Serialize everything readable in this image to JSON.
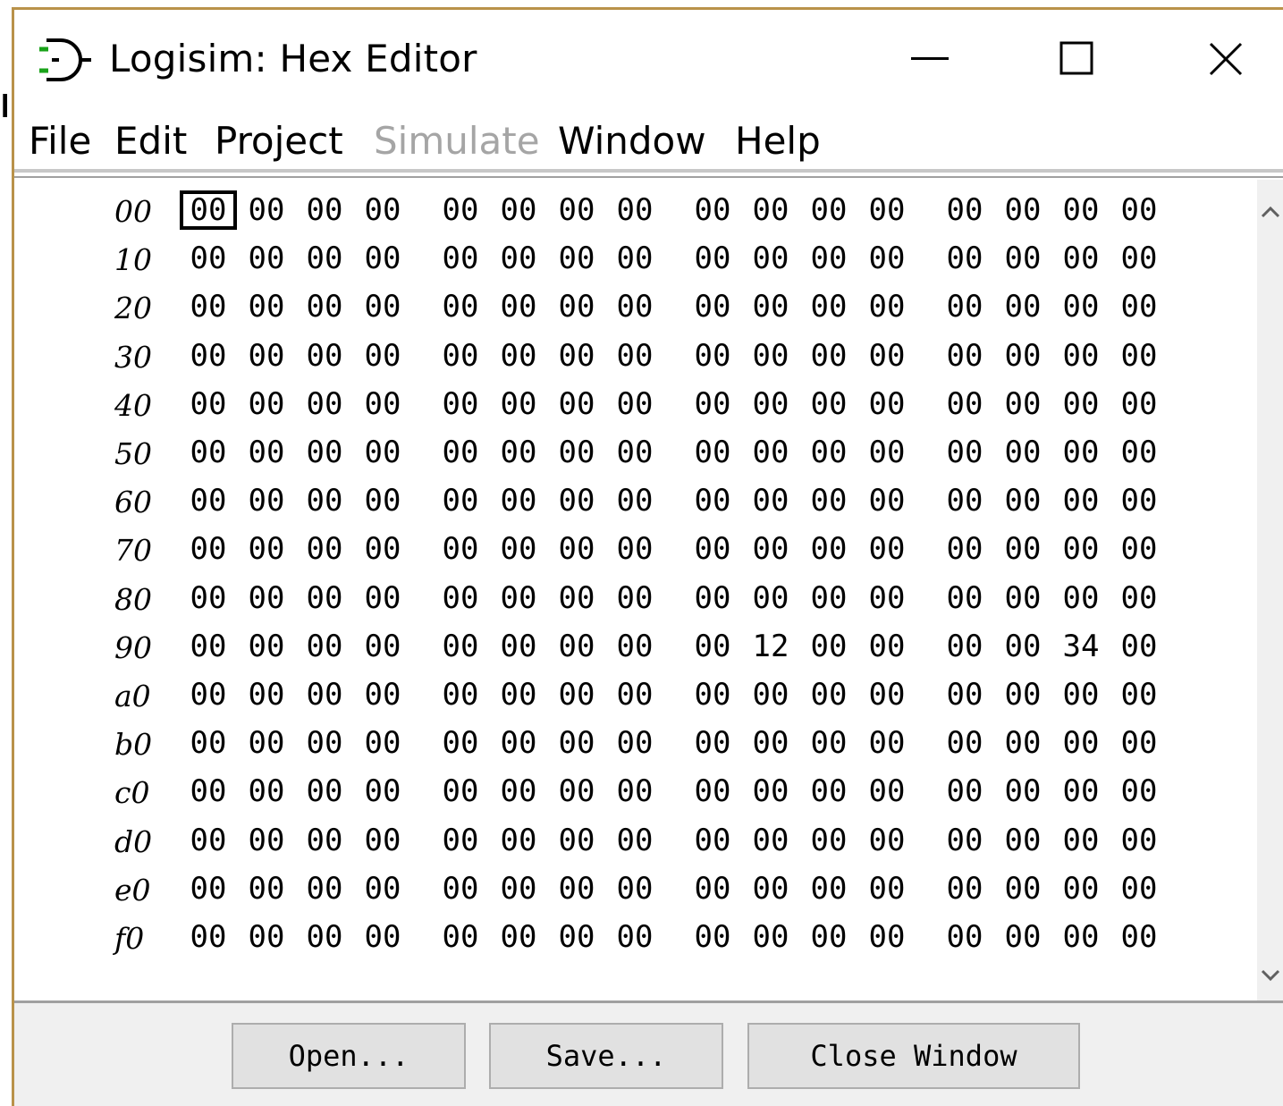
{
  "window": {
    "title": "Logisim: Hex Editor"
  },
  "menu": [
    {
      "label": "File",
      "enabled": true
    },
    {
      "label": "Edit",
      "enabled": true
    },
    {
      "label": "Project",
      "enabled": true
    },
    {
      "label": "Simulate",
      "enabled": false
    },
    {
      "label": "Window",
      "enabled": true
    },
    {
      "label": "Help",
      "enabled": true
    }
  ],
  "hex": {
    "rows": [
      {
        "addr": "00",
        "cells": [
          "00",
          "00",
          "00",
          "00",
          "00",
          "00",
          "00",
          "00",
          "00",
          "00",
          "00",
          "00",
          "00",
          "00",
          "00",
          "00"
        ]
      },
      {
        "addr": "10",
        "cells": [
          "00",
          "00",
          "00",
          "00",
          "00",
          "00",
          "00",
          "00",
          "00",
          "00",
          "00",
          "00",
          "00",
          "00",
          "00",
          "00"
        ]
      },
      {
        "addr": "20",
        "cells": [
          "00",
          "00",
          "00",
          "00",
          "00",
          "00",
          "00",
          "00",
          "00",
          "00",
          "00",
          "00",
          "00",
          "00",
          "00",
          "00"
        ]
      },
      {
        "addr": "30",
        "cells": [
          "00",
          "00",
          "00",
          "00",
          "00",
          "00",
          "00",
          "00",
          "00",
          "00",
          "00",
          "00",
          "00",
          "00",
          "00",
          "00"
        ]
      },
      {
        "addr": "40",
        "cells": [
          "00",
          "00",
          "00",
          "00",
          "00",
          "00",
          "00",
          "00",
          "00",
          "00",
          "00",
          "00",
          "00",
          "00",
          "00",
          "00"
        ]
      },
      {
        "addr": "50",
        "cells": [
          "00",
          "00",
          "00",
          "00",
          "00",
          "00",
          "00",
          "00",
          "00",
          "00",
          "00",
          "00",
          "00",
          "00",
          "00",
          "00"
        ]
      },
      {
        "addr": "60",
        "cells": [
          "00",
          "00",
          "00",
          "00",
          "00",
          "00",
          "00",
          "00",
          "00",
          "00",
          "00",
          "00",
          "00",
          "00",
          "00",
          "00"
        ]
      },
      {
        "addr": "70",
        "cells": [
          "00",
          "00",
          "00",
          "00",
          "00",
          "00",
          "00",
          "00",
          "00",
          "00",
          "00",
          "00",
          "00",
          "00",
          "00",
          "00"
        ]
      },
      {
        "addr": "80",
        "cells": [
          "00",
          "00",
          "00",
          "00",
          "00",
          "00",
          "00",
          "00",
          "00",
          "00",
          "00",
          "00",
          "00",
          "00",
          "00",
          "00"
        ]
      },
      {
        "addr": "90",
        "cells": [
          "00",
          "00",
          "00",
          "00",
          "00",
          "00",
          "00",
          "00",
          "00",
          "12",
          "00",
          "00",
          "00",
          "00",
          "34",
          "00"
        ]
      },
      {
        "addr": "a0",
        "cells": [
          "00",
          "00",
          "00",
          "00",
          "00",
          "00",
          "00",
          "00",
          "00",
          "00",
          "00",
          "00",
          "00",
          "00",
          "00",
          "00"
        ]
      },
      {
        "addr": "b0",
        "cells": [
          "00",
          "00",
          "00",
          "00",
          "00",
          "00",
          "00",
          "00",
          "00",
          "00",
          "00",
          "00",
          "00",
          "00",
          "00",
          "00"
        ]
      },
      {
        "addr": "c0",
        "cells": [
          "00",
          "00",
          "00",
          "00",
          "00",
          "00",
          "00",
          "00",
          "00",
          "00",
          "00",
          "00",
          "00",
          "00",
          "00",
          "00"
        ]
      },
      {
        "addr": "d0",
        "cells": [
          "00",
          "00",
          "00",
          "00",
          "00",
          "00",
          "00",
          "00",
          "00",
          "00",
          "00",
          "00",
          "00",
          "00",
          "00",
          "00"
        ]
      },
      {
        "addr": "e0",
        "cells": [
          "00",
          "00",
          "00",
          "00",
          "00",
          "00",
          "00",
          "00",
          "00",
          "00",
          "00",
          "00",
          "00",
          "00",
          "00",
          "00"
        ]
      },
      {
        "addr": "f0",
        "cells": [
          "00",
          "00",
          "00",
          "00",
          "00",
          "00",
          "00",
          "00",
          "00",
          "00",
          "00",
          "00",
          "00",
          "00",
          "00",
          "00"
        ]
      }
    ],
    "selected": {
      "row": 0,
      "col": 0
    }
  },
  "buttons": {
    "open": "Open...",
    "save": "Save...",
    "close": "Close Window"
  },
  "icons": {
    "app": "logisim-gate-icon",
    "minimize": "minimize-icon",
    "maximize": "maximize-icon",
    "close": "close-icon",
    "scroll_up": "chevron-up-icon",
    "scroll_down": "chevron-down-icon"
  },
  "colors": {
    "window_border": "#b9924a",
    "menu_disabled": "#a5a5a5",
    "footer_bg": "#f0f0f0",
    "button_bg": "#e1e1e1",
    "icon_green": "#1aa31a"
  }
}
